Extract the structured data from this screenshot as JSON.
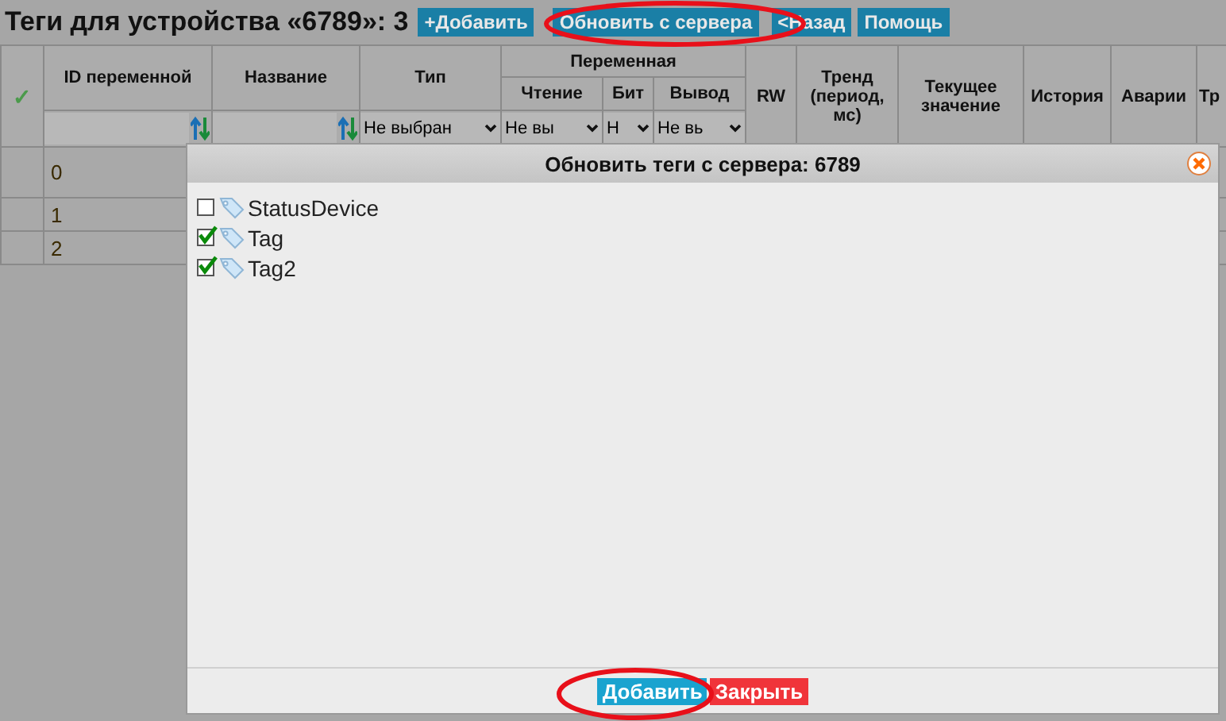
{
  "page": {
    "title": "Теги для устройства «6789»: 3",
    "buttons": [
      "+Добавить",
      "Обновить с сервера",
      "<Назад",
      "Помощь"
    ]
  },
  "table": {
    "group_header": "Переменная",
    "columns": [
      "ID переменной",
      "Название",
      "Тип",
      "Чтение",
      "Бит",
      "Вывод",
      "RW",
      "Тренд (период, мс)",
      "Текущее значение",
      "История",
      "Аварии",
      "Тр"
    ],
    "filters": [
      {
        "kind": "input"
      },
      {
        "kind": "input"
      },
      {
        "kind": "select",
        "value": "Не выбран"
      },
      {
        "kind": "select",
        "value": "Не вы"
      },
      {
        "kind": "select",
        "value": "Н"
      },
      {
        "kind": "select",
        "value": "Не вь"
      }
    ],
    "rows": [
      {
        "id": "0"
      },
      {
        "id": "1"
      },
      {
        "id": "2"
      }
    ],
    "check_mark": "✓"
  },
  "dialog": {
    "title": "Обновить теги с сервера: 6789",
    "tags": [
      {
        "name": "StatusDevice",
        "checked": false
      },
      {
        "name": "Tag",
        "checked": true
      },
      {
        "name": "Tag2",
        "checked": true
      }
    ],
    "add_button": "Добавить",
    "close_button": "Закрыть"
  }
}
